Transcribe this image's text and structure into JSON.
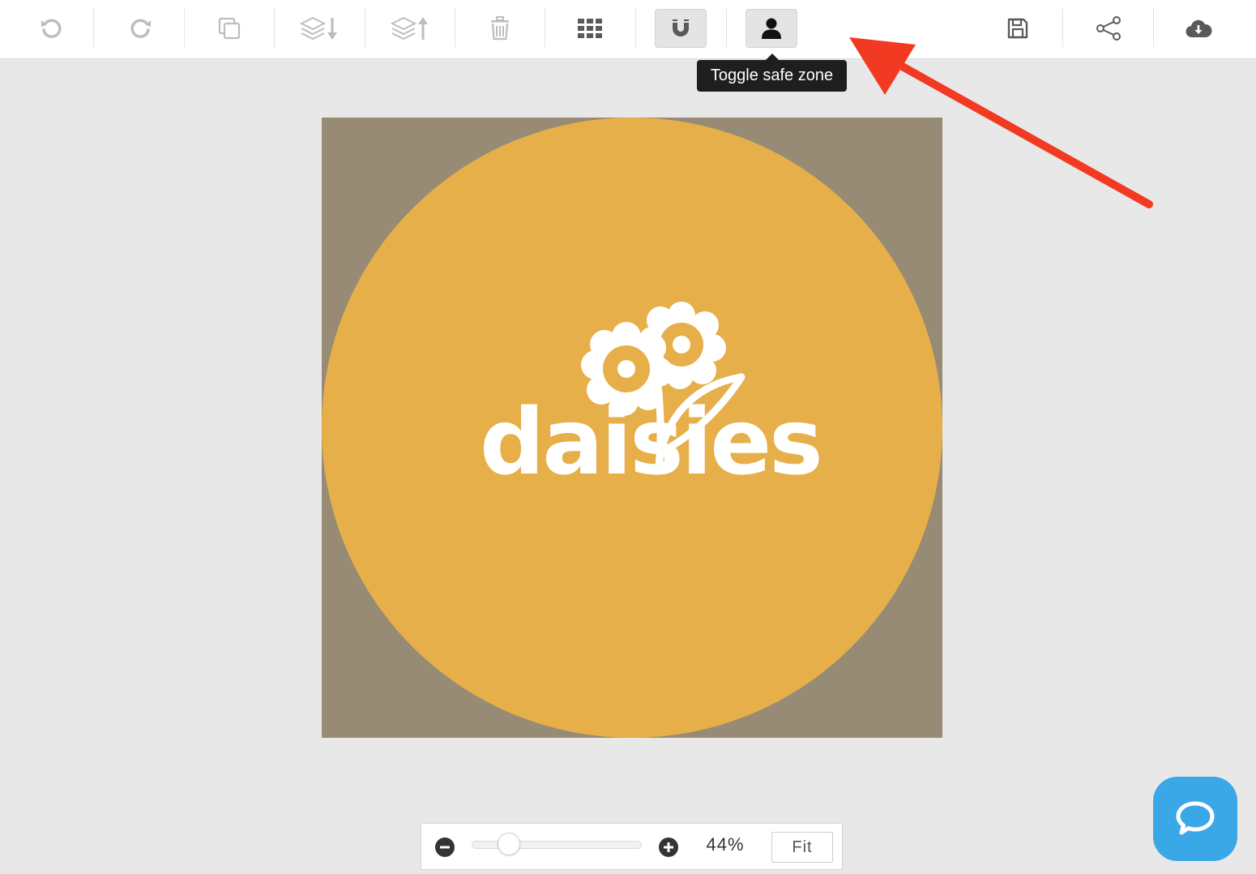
{
  "colors": {
    "icon_disabled": "#bdbdbd",
    "icon_active": "#5a5a5a",
    "canvas_background": "#978b76",
    "circle_fill": "#e6af4a",
    "logo_fill": "#ffffff",
    "chat_button": "#3aa8e6",
    "annotation_arrow": "#f23a22"
  },
  "toolbar": {
    "buttons": [
      {
        "name": "undo",
        "icon": "undo-icon"
      },
      {
        "name": "redo",
        "icon": "redo-icon"
      },
      {
        "name": "duplicate",
        "icon": "duplicate-icon"
      },
      {
        "name": "send-backward",
        "icon": "layers-down-icon"
      },
      {
        "name": "bring-forward",
        "icon": "layers-up-icon"
      },
      {
        "name": "delete",
        "icon": "trash-icon"
      },
      {
        "name": "grid",
        "icon": "grid-icon"
      },
      {
        "name": "snap",
        "icon": "magnet-icon"
      },
      {
        "name": "safe-zone",
        "icon": "user-icon"
      },
      {
        "name": "save",
        "icon": "save-icon"
      },
      {
        "name": "share",
        "icon": "share-icon"
      },
      {
        "name": "download",
        "icon": "cloud-download-icon"
      }
    ]
  },
  "tooltip": {
    "text": "Toggle safe zone"
  },
  "design": {
    "logo_text": "daisies"
  },
  "zoom": {
    "percent_label": "44%",
    "fit_label": "Fit",
    "slider_level_percent": 44
  }
}
